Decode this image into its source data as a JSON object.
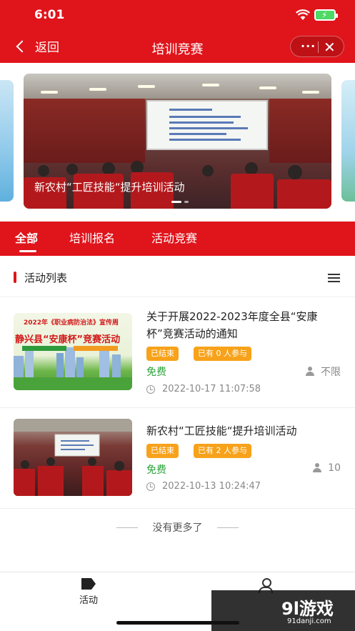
{
  "status_bar": {
    "time": "6:01"
  },
  "nav": {
    "back_label": "返回",
    "title": "培训竞赛",
    "capsule_more": "···",
    "capsule_close": "✕"
  },
  "banner": {
    "caption": "新农村“工匠技能“提升培训活动"
  },
  "tabs": [
    {
      "label": "全部",
      "active": true
    },
    {
      "label": "培训报名",
      "active": false
    },
    {
      "label": "活动竞赛",
      "active": false
    }
  ],
  "list": {
    "title": "活动列表",
    "items": [
      {
        "title": "关于开展2022-2023年度全县“安康杯”竞赛活动的通知",
        "status_badge": "已结束",
        "participants_badge": "已有 0 人参与",
        "price": "免费",
        "limit": "不限",
        "time": "2022-10-17 11:07:58",
        "thumb_title_1": "2022年《职业病防治法》宣传周",
        "thumb_title_2": "静兴县“安康杯”竞赛活动"
      },
      {
        "title": "新农村“工匠技能“提升培训活动",
        "status_badge": "已结束",
        "participants_badge": "已有 2 人参与",
        "price": "免费",
        "limit": "10",
        "time": "2022-10-13 10:24:47"
      }
    ],
    "no_more": "没有更多了"
  },
  "bottom_tabs": [
    {
      "label": "活动"
    },
    {
      "label": ""
    }
  ],
  "watermark": {
    "text": "9l游戏",
    "sub": "91danji.com"
  },
  "colors": {
    "primary": "#e0141b",
    "badge": "#f7a21a",
    "price": "#2aa33a"
  }
}
